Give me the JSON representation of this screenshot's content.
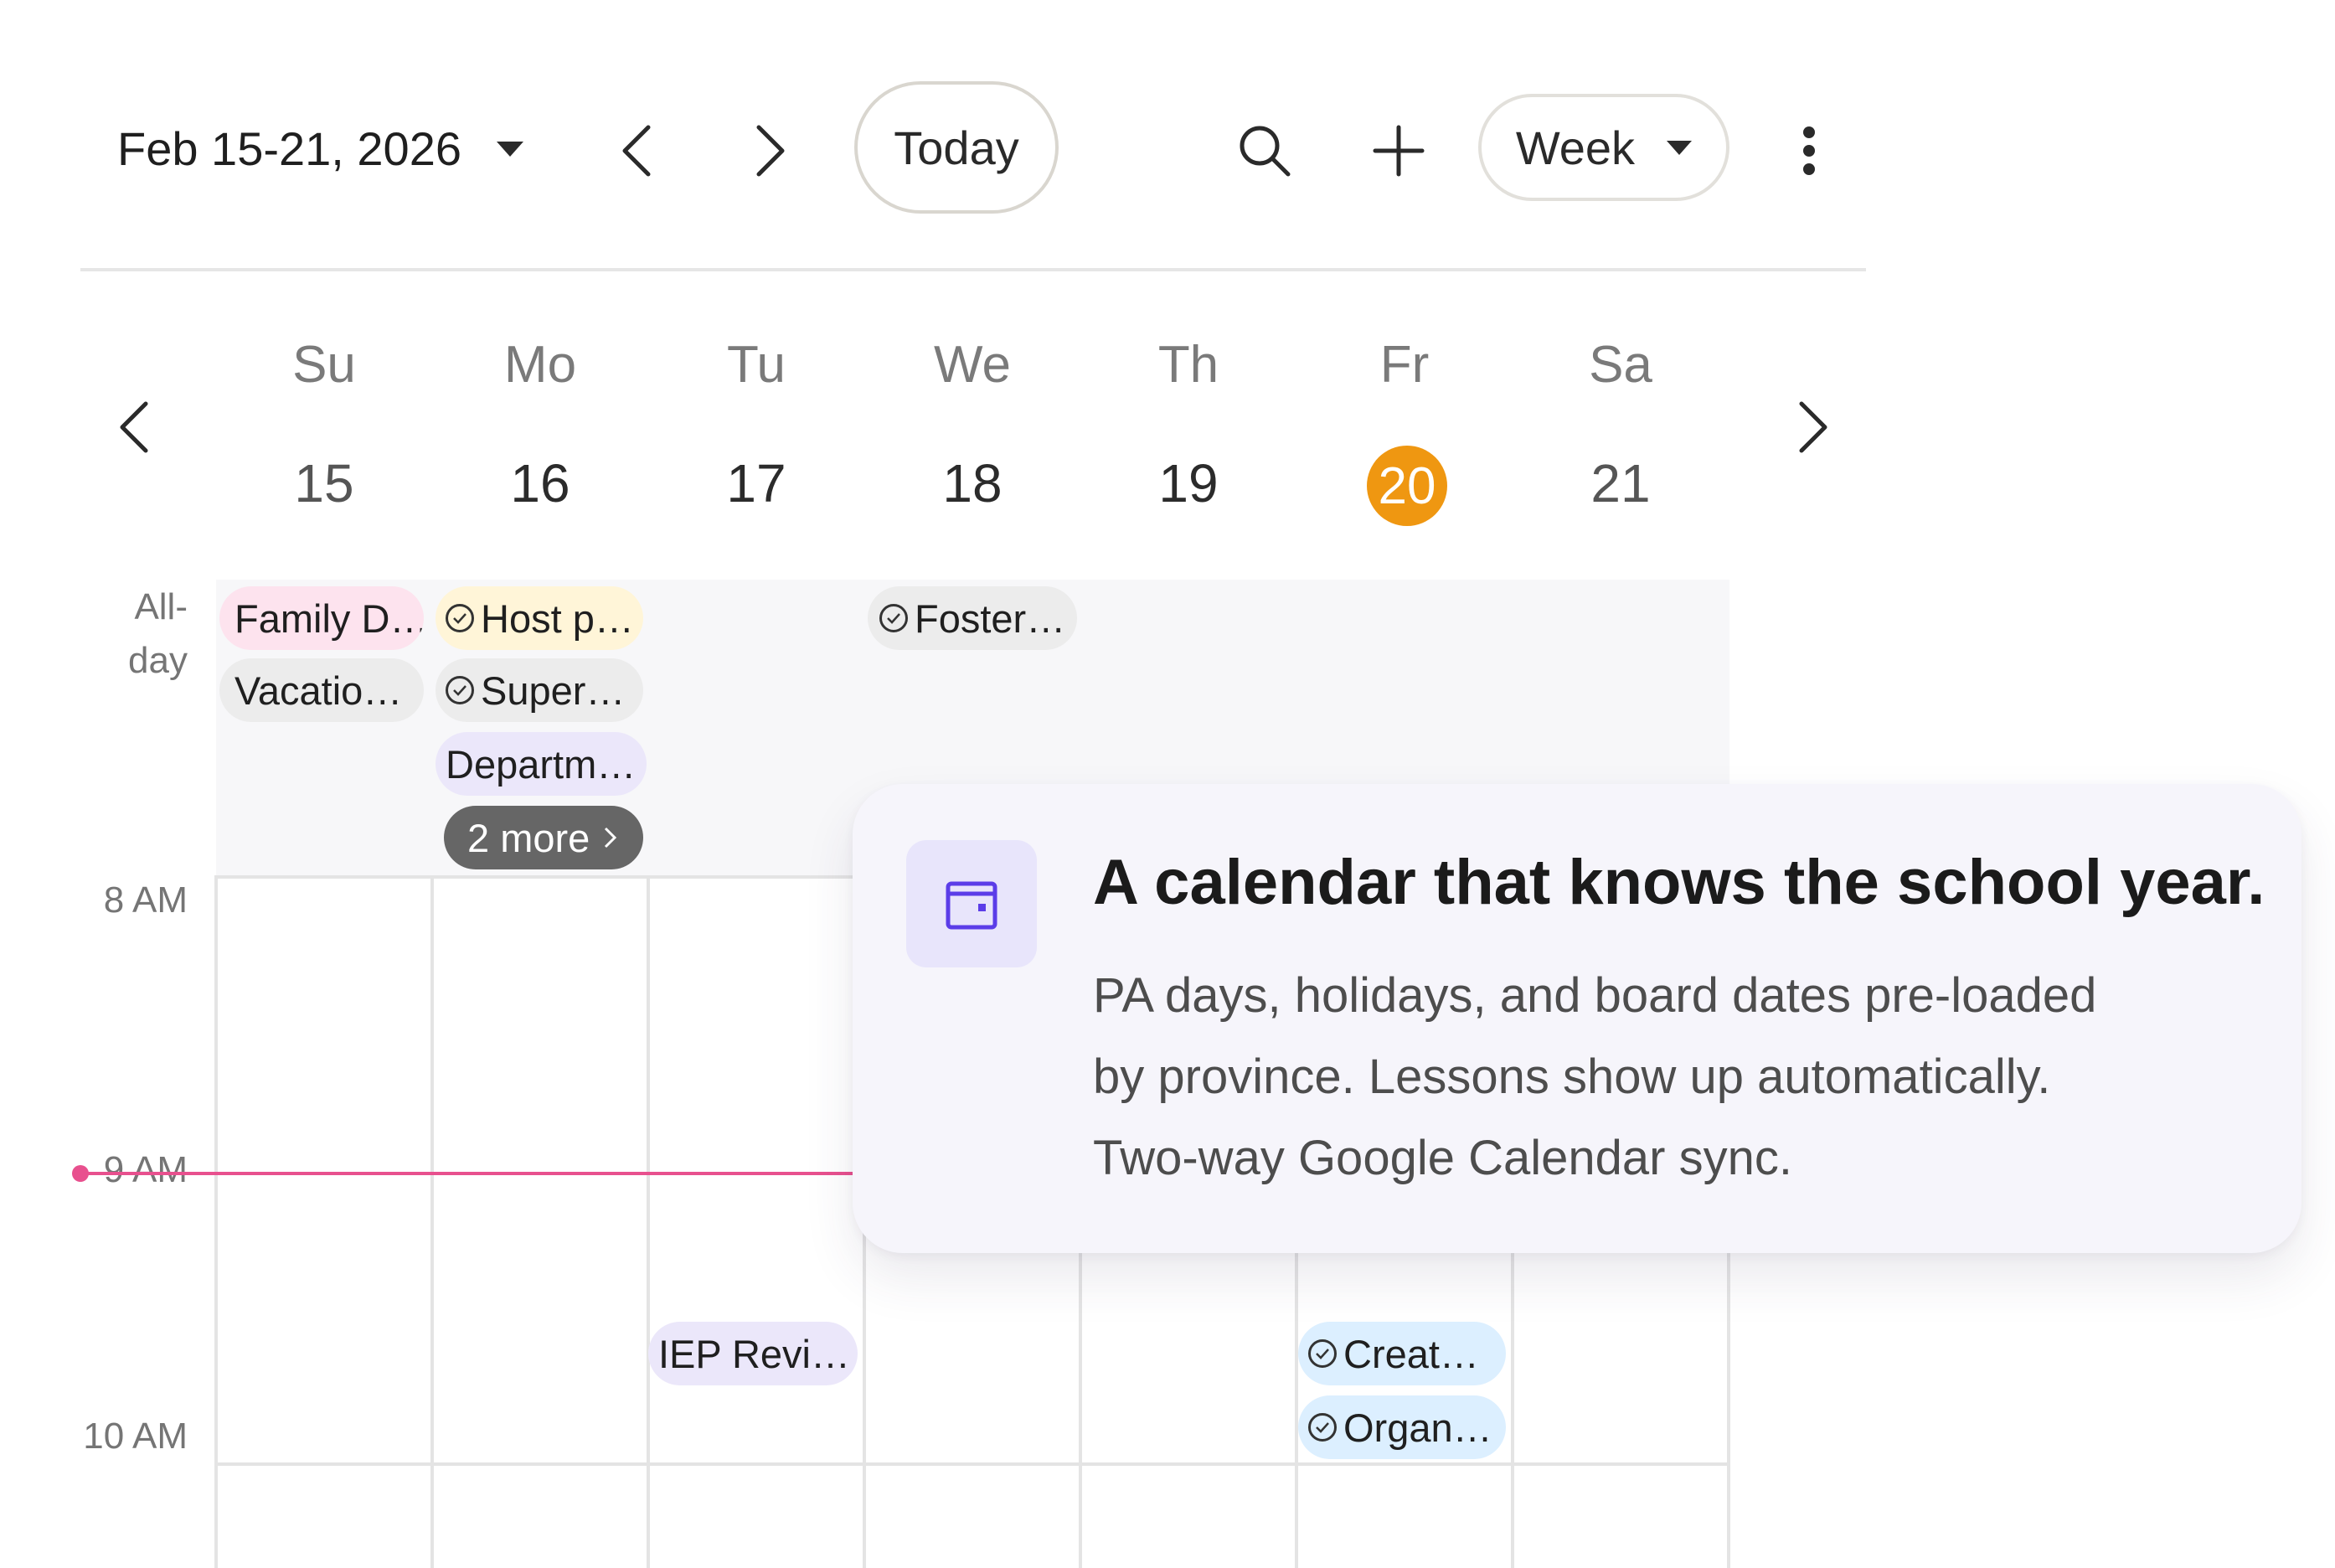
{
  "toolbar": {
    "date_range": "Feb 15-21, 2026",
    "today_label": "Today",
    "view_label": "Week",
    "icons": [
      "chevron-left-icon",
      "chevron-right-icon",
      "search-icon",
      "plus-icon",
      "more-vert-icon"
    ]
  },
  "days": [
    {
      "dow": "Su",
      "num": "15"
    },
    {
      "dow": "Mo",
      "num": "16"
    },
    {
      "dow": "Tu",
      "num": "17"
    },
    {
      "dow": "We",
      "num": "18"
    },
    {
      "dow": "Th",
      "num": "19"
    },
    {
      "dow": "Fr",
      "num": "20",
      "today": true
    },
    {
      "dow": "Sa",
      "num": "21"
    }
  ],
  "allday": {
    "label_line1": "All-",
    "label_line2": "day",
    "events": {
      "su_1": "Family D…",
      "su_2": "Vacatio…",
      "mo_1": "Host p…",
      "mo_2": "Super…",
      "mo_3": "Departm…",
      "mo_more": "2 more",
      "we_1": "Foster…"
    }
  },
  "times": {
    "t8": "8 AM",
    "t9": "9 AM",
    "t10": "10 AM"
  },
  "timed_events": {
    "tu_1": "IEP Revi…",
    "fr_1": "Creat…",
    "fr_2": "Organ…"
  },
  "promo": {
    "title": "A calendar that knows the school year.",
    "line1": "PA days, holidays, and board dates pre-loaded",
    "line2": "by province. Lessons show up automatically.",
    "line3": "Two-way Google Calendar sync."
  },
  "colors": {
    "today_accent": "#ef9711",
    "now_line": "#e8508e",
    "promo_icon": "#5b3de8"
  }
}
